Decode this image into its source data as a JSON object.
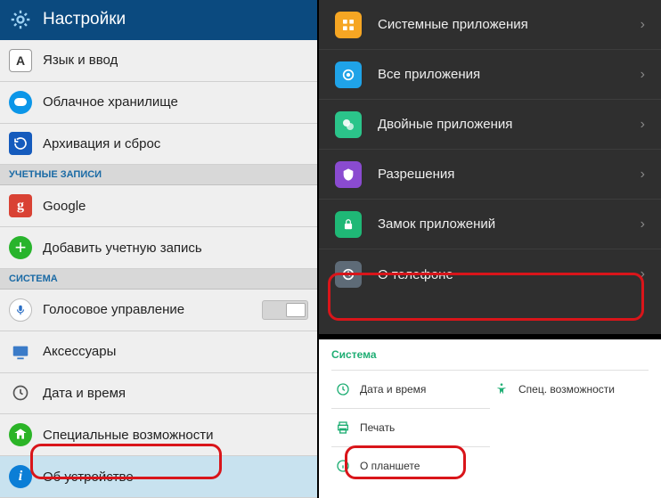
{
  "left": {
    "title": "Настройки",
    "items": {
      "language": "Язык и ввод",
      "cloud": "Облачное хранилище",
      "backup": "Архивация и сброс",
      "google": "Google",
      "add_account": "Добавить учетную запись",
      "voice": "Голосовое управление",
      "accessories": "Аксессуары",
      "datetime": "Дата и время",
      "accessibility": "Специальные возможности",
      "about": "Об устройстве"
    },
    "sections": {
      "accounts": "УЧЕТНЫЕ ЗАПИСИ",
      "system": "СИСТЕМА"
    }
  },
  "dark": {
    "system_apps": "Системные приложения",
    "all_apps": "Все приложения",
    "dual_apps": "Двойные приложения",
    "permissions": "Разрешения",
    "app_lock": "Замок приложений",
    "about_phone": "О телефоне"
  },
  "light": {
    "section": "Система",
    "datetime": "Дата и время",
    "accessibility": "Спец. возможности",
    "print": "Печать",
    "about_tablet": "О планшете"
  }
}
